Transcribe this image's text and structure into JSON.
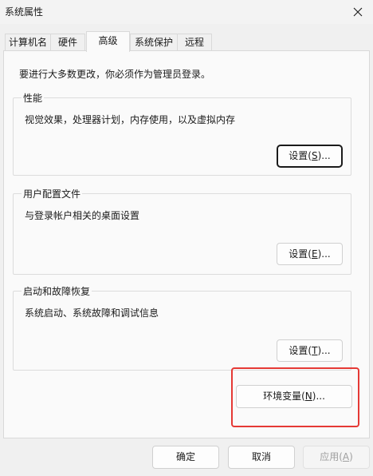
{
  "window": {
    "title": "系统属性"
  },
  "tabs": [
    {
      "label": "计算机名",
      "active": false
    },
    {
      "label": "硬件",
      "active": false
    },
    {
      "label": "高级",
      "active": true
    },
    {
      "label": "系统保护",
      "active": false
    },
    {
      "label": "远程",
      "active": false
    }
  ],
  "intro_text": "要进行大多数更改，你必须作为管理员登录。",
  "performance": {
    "title": "性能",
    "description": "视觉效果，处理器计划，内存使用，以及虚拟内存",
    "button": {
      "label": "设置",
      "accel": "S",
      "suffix": "..."
    }
  },
  "user_profiles": {
    "title": "用户配置文件",
    "description": "与登录帐户相关的桌面设置",
    "button": {
      "label": "设置",
      "accel": "E",
      "suffix": "..."
    }
  },
  "startup_recovery": {
    "title": "启动和故障恢复",
    "description": "系统启动、系统故障和调试信息",
    "button": {
      "label": "设置",
      "accel": "T",
      "suffix": "..."
    }
  },
  "env_button": {
    "label": "环境变量",
    "accel": "N",
    "suffix": "..."
  },
  "footer": {
    "ok": "确定",
    "cancel": "取消",
    "apply_label": "应用",
    "apply_accel": "A"
  },
  "highlight_color": "#e53935"
}
